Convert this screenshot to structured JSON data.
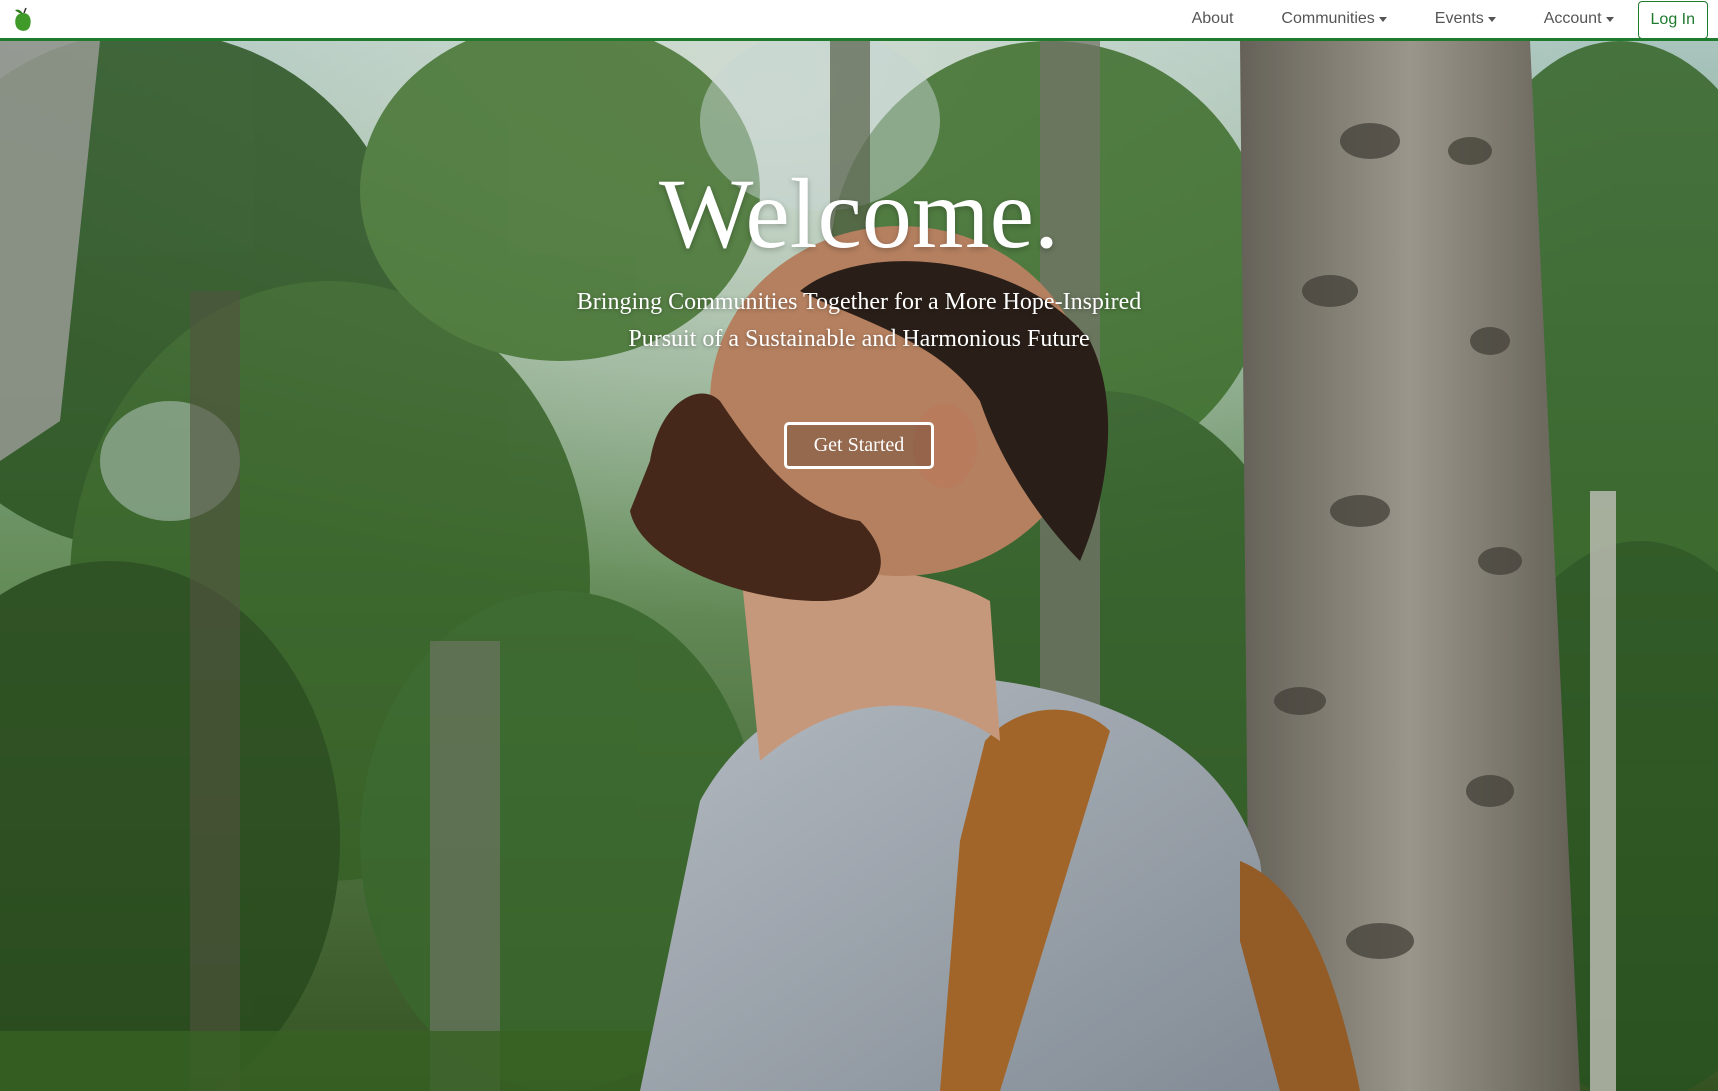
{
  "nav": {
    "brand_icon": "pear-leaf-logo-icon",
    "items": [
      {
        "label": "About",
        "dropdown": false
      },
      {
        "label": "Communities",
        "dropdown": true
      },
      {
        "label": "Events",
        "dropdown": true
      },
      {
        "label": "Account",
        "dropdown": true
      }
    ],
    "login_label": "Log In",
    "accent_color": "#1f7a2e"
  },
  "hero": {
    "title": "Welcome.",
    "subtitle_line1": "Bringing Communities Together for a More Hope-Inspired",
    "subtitle_line2": "Pursuit of a Sustainable and Harmonious Future",
    "cta_label": "Get Started",
    "background": "forest-hiker-photo"
  }
}
